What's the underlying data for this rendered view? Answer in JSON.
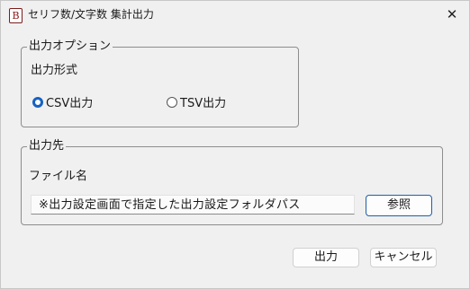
{
  "window": {
    "title": "セリフ数/文字数 集計出力",
    "icon_glyph": "B",
    "close_glyph": "✕"
  },
  "options_group": {
    "legend": "出力オプション",
    "format_label": "出力形式",
    "radios": [
      {
        "label": "CSV出力",
        "checked": true
      },
      {
        "label": "TSV出力",
        "checked": false
      }
    ]
  },
  "destination_group": {
    "legend": "出力先",
    "filename_label": "ファイル名",
    "path_value": "※出力設定画面で指定した出力設定フォルダパス",
    "browse_label": "参照"
  },
  "footer": {
    "output_label": "出力",
    "cancel_label": "キャンセル"
  },
  "colors": {
    "accent": "#1562c2",
    "background": "#f0f0f0"
  }
}
